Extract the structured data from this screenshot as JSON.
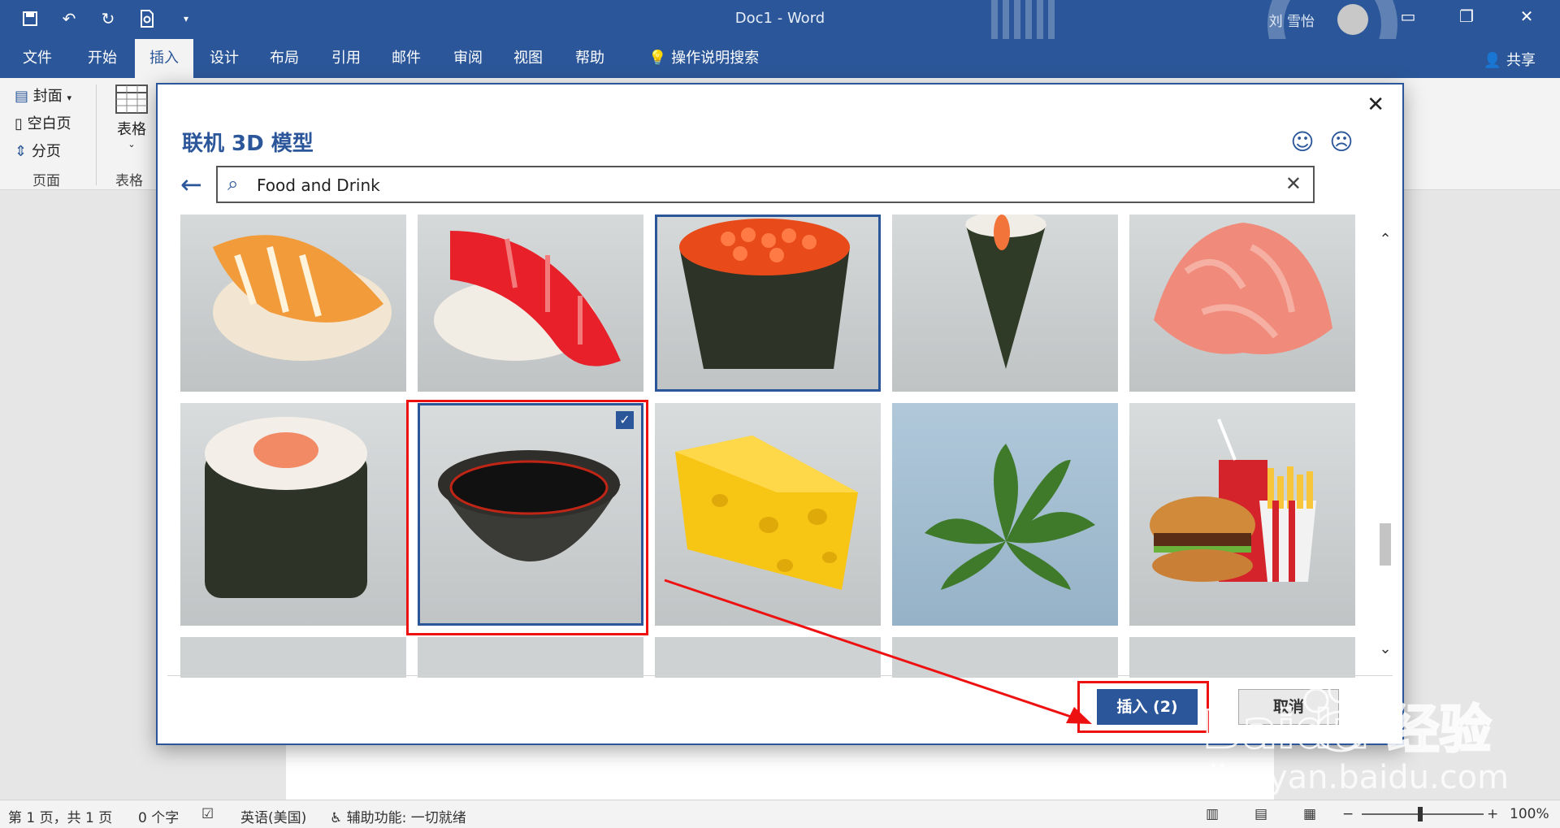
{
  "window": {
    "doc_title": "Doc1  -  Word",
    "user_name": "刘 雪怡",
    "share_label": "共享"
  },
  "menu": {
    "tabs": [
      "文件",
      "开始",
      "插入",
      "设计",
      "布局",
      "引用",
      "邮件",
      "审阅",
      "视图",
      "帮助"
    ],
    "active_tab": "插入",
    "tell_me": "操作说明搜索"
  },
  "ribbon": {
    "cover_page": "封面",
    "blank_page": "空白页",
    "page_break": "分页",
    "pages_group": "页面",
    "table_button": "表格",
    "tables_group": "表格"
  },
  "dialog": {
    "title": "联机 3D 模型",
    "search_value": "Food and Drink",
    "insert_button": "插入 (2)",
    "cancel_button": "取消",
    "tiles": [
      {
        "name": "shrimp-nigiri",
        "selected": false
      },
      {
        "name": "tuna-nigiri",
        "selected": false
      },
      {
        "name": "ikura-gunkan",
        "selected": true
      },
      {
        "name": "temaki-hand-roll",
        "selected": false
      },
      {
        "name": "pickled-ginger",
        "selected": false
      },
      {
        "name": "salmon-maki",
        "selected": false
      },
      {
        "name": "soy-sauce-bowl",
        "selected": true
      },
      {
        "name": "cheese-wedge",
        "selected": false
      },
      {
        "name": "green-plant",
        "selected": false
      },
      {
        "name": "burger-fries-soda",
        "selected": false
      }
    ]
  },
  "status": {
    "page_info": "第 1 页，共 1 页",
    "word_count": "0 个字",
    "language": "英语(美国)",
    "accessibility": "辅助功能: 一切就绪",
    "zoom": "100%"
  },
  "watermark": {
    "brand": "Baidu 经验",
    "url": "jingyan.baidu.com"
  },
  "colors": {
    "word_blue": "#2b579a",
    "highlight_red": "#e11"
  }
}
